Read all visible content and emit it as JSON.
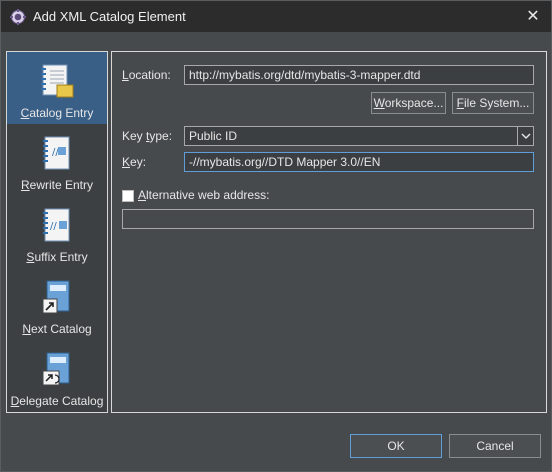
{
  "window": {
    "title": "Add XML Catalog Element",
    "close_glyph": "✕"
  },
  "sidebar": {
    "items": [
      {
        "label_mnemonic": "C",
        "label_rest": "atalog Entry",
        "icon": "catalog-entry-icon",
        "selected": true
      },
      {
        "label_mnemonic": "R",
        "label_rest": "ewrite Entry",
        "icon": "rewrite-entry-icon",
        "selected": false
      },
      {
        "label_mnemonic": "S",
        "label_rest": "uffix Entry",
        "icon": "suffix-entry-icon",
        "selected": false
      },
      {
        "label_mnemonic": "N",
        "label_rest": "ext Catalog",
        "icon": "next-catalog-icon",
        "selected": false
      },
      {
        "label_mnemonic": "D",
        "label_rest": "elegate Catalog",
        "icon": "delegate-catalog-icon",
        "selected": false
      }
    ]
  },
  "form": {
    "location_label_mnemonic": "L",
    "location_label_rest": "ocation:",
    "location_value": "http://mybatis.org/dtd/mybatis-3-mapper.dtd",
    "workspace_mnemonic": "W",
    "workspace_rest": "orkspace...",
    "filesystem_mnemonic": "F",
    "filesystem_rest": "ile System...",
    "key_type_label_pre": "Key ",
    "key_type_label_mnemonic": "t",
    "key_type_label_rest": "ype:",
    "key_type_value": "Public ID",
    "key_label_mnemonic": "K",
    "key_label_rest": "ey:",
    "key_value": "-//mybatis.org//DTD Mapper 3.0//EN",
    "alt_web_mnemonic": "A",
    "alt_web_rest": "lternative web address:",
    "alt_web_checked": false,
    "alt_web_value": ""
  },
  "footer": {
    "ok_label": "OK",
    "cancel_label": "Cancel"
  },
  "colors": {
    "selection": "#3a5f87",
    "focus_border": "#5f9ed8",
    "panel_bg": "#474a4d"
  }
}
